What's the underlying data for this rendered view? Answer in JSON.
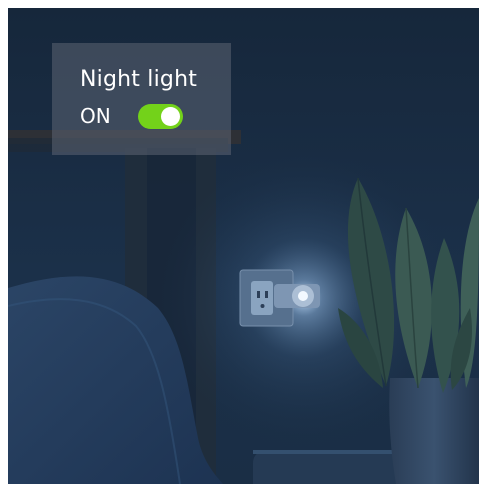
{
  "night_light": {
    "title": "Night light",
    "state_label": "ON",
    "enabled": true,
    "toggle_color": "#73d21a"
  },
  "icons": {
    "toggle": "toggle-switch"
  },
  "colors": {
    "background": "#17283d",
    "overlay": "#5c6472"
  }
}
